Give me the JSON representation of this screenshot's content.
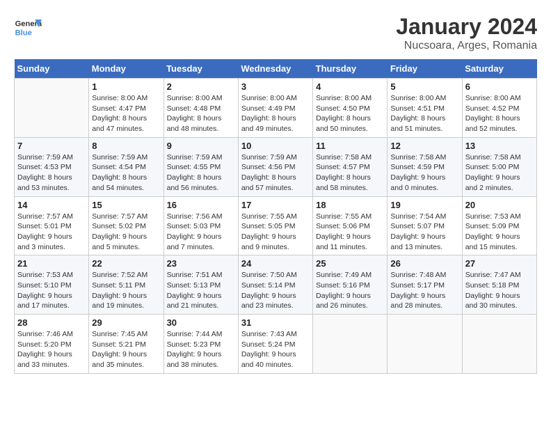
{
  "header": {
    "logo_line1": "General",
    "logo_line2": "Blue",
    "title": "January 2024",
    "subtitle": "Nucsoara, Arges, Romania"
  },
  "weekdays": [
    "Sunday",
    "Monday",
    "Tuesday",
    "Wednesday",
    "Thursday",
    "Friday",
    "Saturday"
  ],
  "weeks": [
    [
      {
        "day": "",
        "info": ""
      },
      {
        "day": "1",
        "info": "Sunrise: 8:00 AM\nSunset: 4:47 PM\nDaylight: 8 hours\nand 47 minutes."
      },
      {
        "day": "2",
        "info": "Sunrise: 8:00 AM\nSunset: 4:48 PM\nDaylight: 8 hours\nand 48 minutes."
      },
      {
        "day": "3",
        "info": "Sunrise: 8:00 AM\nSunset: 4:49 PM\nDaylight: 8 hours\nand 49 minutes."
      },
      {
        "day": "4",
        "info": "Sunrise: 8:00 AM\nSunset: 4:50 PM\nDaylight: 8 hours\nand 50 minutes."
      },
      {
        "day": "5",
        "info": "Sunrise: 8:00 AM\nSunset: 4:51 PM\nDaylight: 8 hours\nand 51 minutes."
      },
      {
        "day": "6",
        "info": "Sunrise: 8:00 AM\nSunset: 4:52 PM\nDaylight: 8 hours\nand 52 minutes."
      }
    ],
    [
      {
        "day": "7",
        "info": "Sunrise: 7:59 AM\nSunset: 4:53 PM\nDaylight: 8 hours\nand 53 minutes."
      },
      {
        "day": "8",
        "info": "Sunrise: 7:59 AM\nSunset: 4:54 PM\nDaylight: 8 hours\nand 54 minutes."
      },
      {
        "day": "9",
        "info": "Sunrise: 7:59 AM\nSunset: 4:55 PM\nDaylight: 8 hours\nand 56 minutes."
      },
      {
        "day": "10",
        "info": "Sunrise: 7:59 AM\nSunset: 4:56 PM\nDaylight: 8 hours\nand 57 minutes."
      },
      {
        "day": "11",
        "info": "Sunrise: 7:58 AM\nSunset: 4:57 PM\nDaylight: 8 hours\nand 58 minutes."
      },
      {
        "day": "12",
        "info": "Sunrise: 7:58 AM\nSunset: 4:59 PM\nDaylight: 9 hours\nand 0 minutes."
      },
      {
        "day": "13",
        "info": "Sunrise: 7:58 AM\nSunset: 5:00 PM\nDaylight: 9 hours\nand 2 minutes."
      }
    ],
    [
      {
        "day": "14",
        "info": "Sunrise: 7:57 AM\nSunset: 5:01 PM\nDaylight: 9 hours\nand 3 minutes."
      },
      {
        "day": "15",
        "info": "Sunrise: 7:57 AM\nSunset: 5:02 PM\nDaylight: 9 hours\nand 5 minutes."
      },
      {
        "day": "16",
        "info": "Sunrise: 7:56 AM\nSunset: 5:03 PM\nDaylight: 9 hours\nand 7 minutes."
      },
      {
        "day": "17",
        "info": "Sunrise: 7:55 AM\nSunset: 5:05 PM\nDaylight: 9 hours\nand 9 minutes."
      },
      {
        "day": "18",
        "info": "Sunrise: 7:55 AM\nSunset: 5:06 PM\nDaylight: 9 hours\nand 11 minutes."
      },
      {
        "day": "19",
        "info": "Sunrise: 7:54 AM\nSunset: 5:07 PM\nDaylight: 9 hours\nand 13 minutes."
      },
      {
        "day": "20",
        "info": "Sunrise: 7:53 AM\nSunset: 5:09 PM\nDaylight: 9 hours\nand 15 minutes."
      }
    ],
    [
      {
        "day": "21",
        "info": "Sunrise: 7:53 AM\nSunset: 5:10 PM\nDaylight: 9 hours\nand 17 minutes."
      },
      {
        "day": "22",
        "info": "Sunrise: 7:52 AM\nSunset: 5:11 PM\nDaylight: 9 hours\nand 19 minutes."
      },
      {
        "day": "23",
        "info": "Sunrise: 7:51 AM\nSunset: 5:13 PM\nDaylight: 9 hours\nand 21 minutes."
      },
      {
        "day": "24",
        "info": "Sunrise: 7:50 AM\nSunset: 5:14 PM\nDaylight: 9 hours\nand 23 minutes."
      },
      {
        "day": "25",
        "info": "Sunrise: 7:49 AM\nSunset: 5:16 PM\nDaylight: 9 hours\nand 26 minutes."
      },
      {
        "day": "26",
        "info": "Sunrise: 7:48 AM\nSunset: 5:17 PM\nDaylight: 9 hours\nand 28 minutes."
      },
      {
        "day": "27",
        "info": "Sunrise: 7:47 AM\nSunset: 5:18 PM\nDaylight: 9 hours\nand 30 minutes."
      }
    ],
    [
      {
        "day": "28",
        "info": "Sunrise: 7:46 AM\nSunset: 5:20 PM\nDaylight: 9 hours\nand 33 minutes."
      },
      {
        "day": "29",
        "info": "Sunrise: 7:45 AM\nSunset: 5:21 PM\nDaylight: 9 hours\nand 35 minutes."
      },
      {
        "day": "30",
        "info": "Sunrise: 7:44 AM\nSunset: 5:23 PM\nDaylight: 9 hours\nand 38 minutes."
      },
      {
        "day": "31",
        "info": "Sunrise: 7:43 AM\nSunset: 5:24 PM\nDaylight: 9 hours\nand 40 minutes."
      },
      {
        "day": "",
        "info": ""
      },
      {
        "day": "",
        "info": ""
      },
      {
        "day": "",
        "info": ""
      }
    ]
  ]
}
